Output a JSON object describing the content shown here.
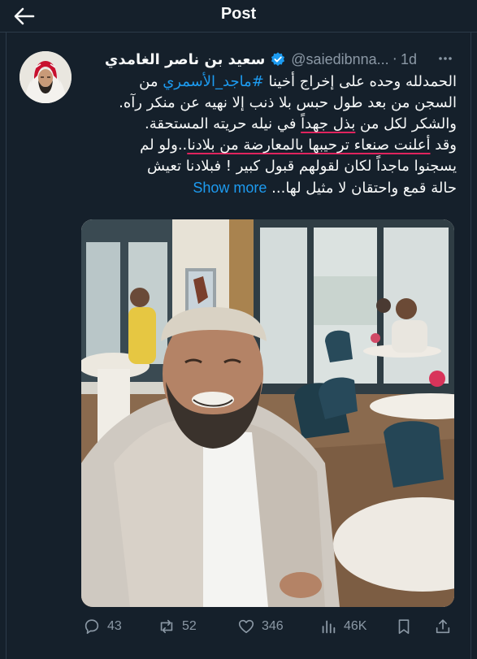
{
  "topbar": {
    "title": "Post"
  },
  "tweet": {
    "author_name": "سعيد بن ناصر الغامدي",
    "handle": "@saiedibnna...",
    "separator": "·",
    "time": "1d",
    "lines": {
      "l1_a": "الحمدلله وحده على إخراج أخينا ",
      "l1_hashtag": "#ماجد_الأسمري",
      "l1_b": " من",
      "l2": "السجن من بعد طول حبس بلا ذنب إلا نهيه عن منكر رآه.",
      "l3_a": "والشكر لكل من ",
      "l3_u": "بذل جهداً",
      "l3_b": " في نيله حريته المستحقة.",
      "l4_a": "وقد ",
      "l4_u": "أعلنت صنعاء ترحيبها بالمعارضة من بلادنا",
      "l4_b": "..ولو لم",
      "l5": "يسجنوا ماجداً لكان لقولهم قبول كبير ! فبلادنا تعيش",
      "l6": "حالة قمع واحتقان لا مثيل لها...",
      "show_more": "Show more"
    }
  },
  "actions": {
    "replies": "43",
    "reposts": "52",
    "likes": "346",
    "views": "46K"
  },
  "colors": {
    "background": "#15202b",
    "accent": "#1d9bf0",
    "muted": "#8b98a5",
    "underline": "#e0245e"
  },
  "icons": [
    "back-arrow-icon",
    "verified-badge-icon",
    "more-icon",
    "reply-icon",
    "repost-icon",
    "like-icon",
    "views-icon",
    "bookmark-icon",
    "share-icon"
  ]
}
